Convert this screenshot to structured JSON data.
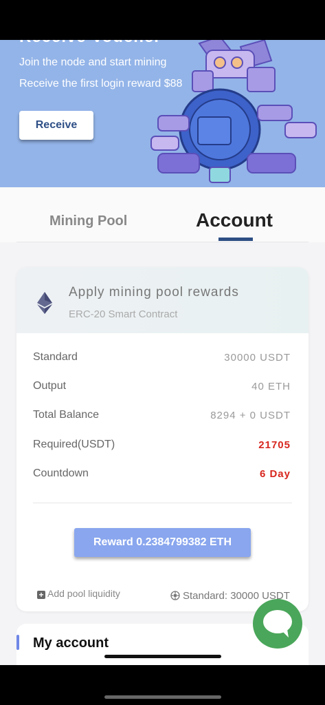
{
  "banner": {
    "title": "Receive Voucher",
    "line1": "Join the node and start mining",
    "line2": "Receive the first login reward $88",
    "receive_button": "Receive"
  },
  "tabs": [
    {
      "label": "Mining Pool",
      "active": false
    },
    {
      "label": "Account",
      "active": true
    }
  ],
  "pool_card": {
    "title": "Apply mining pool rewards",
    "subtitle": "ERC-20 Smart Contract",
    "rows": [
      {
        "label": "Standard",
        "value": "30000 USDT"
      },
      {
        "label": "Output",
        "value": "40 ETH"
      },
      {
        "label": "Total Balance",
        "value": "8294 + 0 USDT"
      },
      {
        "label": "Required(USDT)",
        "value": "21705"
      },
      {
        "label": "Countdown",
        "value": "6 Day"
      }
    ],
    "reward_button": "Reward 0.2384799382 ETH",
    "add_liquidity": "Add pool liquidity",
    "standard_footer": "Standard: 30000 USDT"
  },
  "my_account": {
    "title": "My account"
  },
  "colors": {
    "banner_bg": "#93b4e8",
    "accent": "#2d4f84",
    "reward_button": "#89a6ee",
    "danger": "#d7261e",
    "chat": "#4aa65a"
  },
  "icons": {
    "token": "ethereum-icon",
    "add": "plus-square-icon",
    "standard": "gear-badge-icon",
    "chat": "chat-bubble-icon"
  }
}
